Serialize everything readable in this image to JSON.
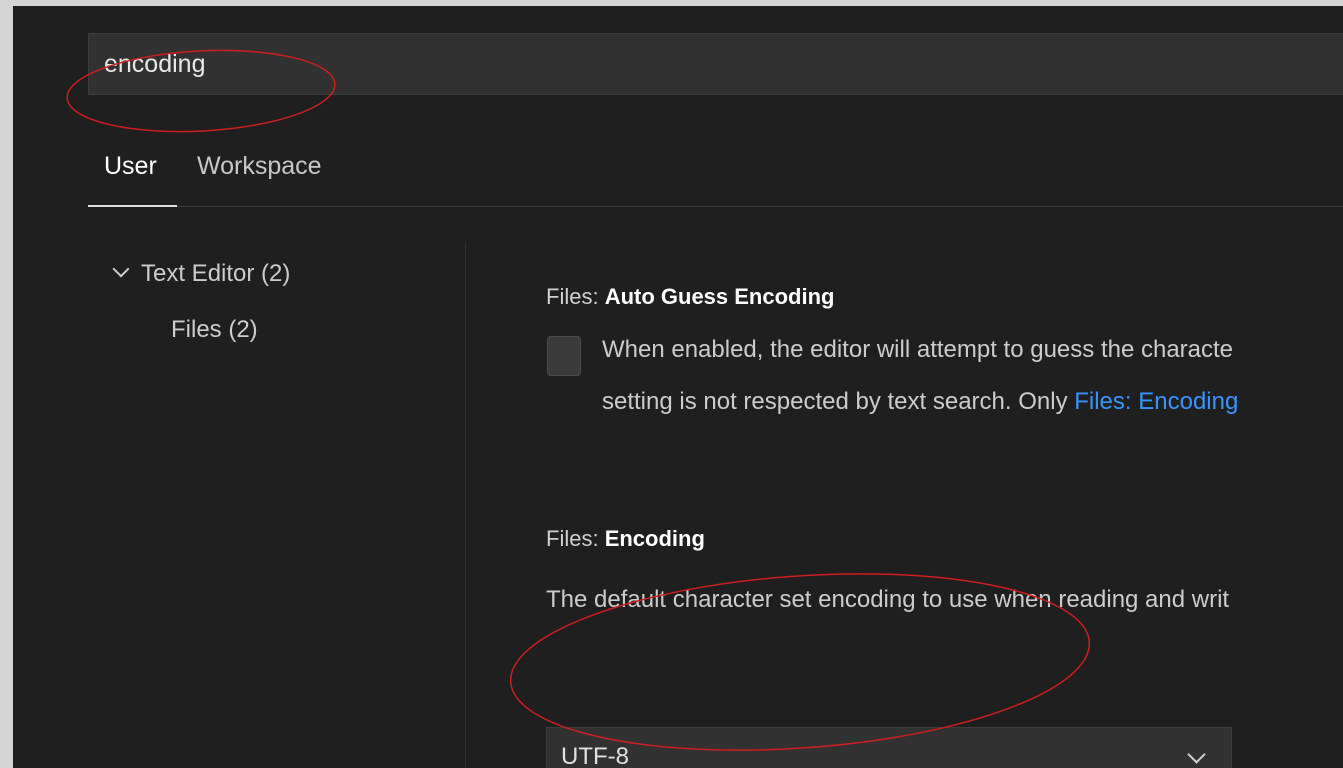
{
  "search": {
    "value": "encoding",
    "placeholder": ""
  },
  "tabs": [
    {
      "label": "User"
    },
    {
      "label": "Workspace"
    }
  ],
  "toc": {
    "items": [
      {
        "label": "Text Editor (2)"
      },
      {
        "label": "Files (2)"
      }
    ]
  },
  "settings": [
    {
      "category": "Files: ",
      "name": "Auto Guess Encoding",
      "desc_line1": "When enabled, the editor will attempt to guess the characte",
      "desc_line2_prefix": "setting is not respected by text search. Only ",
      "desc_line2_link": "Files: Encoding"
    },
    {
      "category": "Files: ",
      "name": "Encoding",
      "desc": "The default character set encoding to use when reading and writ",
      "value": "UTF-8"
    }
  ],
  "colors": {
    "background": "#1f1f1f",
    "input_background": "#313131",
    "link": "#3794ff",
    "annotation": "#cc1f1f"
  },
  "icons": {
    "toc_expand": "chevron-down-icon",
    "select_dropdown": "chevron-down-icon"
  }
}
